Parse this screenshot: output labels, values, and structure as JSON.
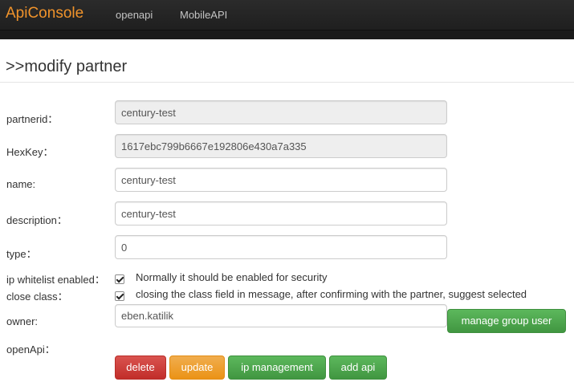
{
  "navbar": {
    "brand": "ApiConsole",
    "links": [
      "openapi",
      "MobileAPI"
    ]
  },
  "page": {
    "title": ">>modify partner"
  },
  "form": {
    "partnerid": {
      "label": "partnerid：",
      "value": "century-test"
    },
    "hexkey": {
      "label": "HexKey：",
      "value": "1617ebc799b6667e192806e430a7a335"
    },
    "name": {
      "label": "name:",
      "value": "century-test"
    },
    "description": {
      "label": "description：",
      "value": "century-test"
    },
    "type": {
      "label": "type：",
      "value": "0"
    },
    "ip_whitelist": {
      "label": "ip whitelist enabled：",
      "checked": true,
      "hint": "Normally it should be enabled for security"
    },
    "close_class": {
      "label": "close class：",
      "checked": true,
      "hint": "closing the class field in message, after confirming with the partner, suggest selected"
    },
    "owner": {
      "label": "owner:",
      "value": "eben.katilik"
    },
    "openapi": {
      "label": "openApi："
    }
  },
  "buttons": {
    "manage_group_user": "manage group user",
    "delete": "delete",
    "update": "update",
    "ip_management": "ip management",
    "add_api": "add api"
  },
  "colors": {
    "brand": "#f0932b",
    "danger": "#d9534f",
    "warning": "#f0ad4e",
    "success": "#5cb85c"
  }
}
